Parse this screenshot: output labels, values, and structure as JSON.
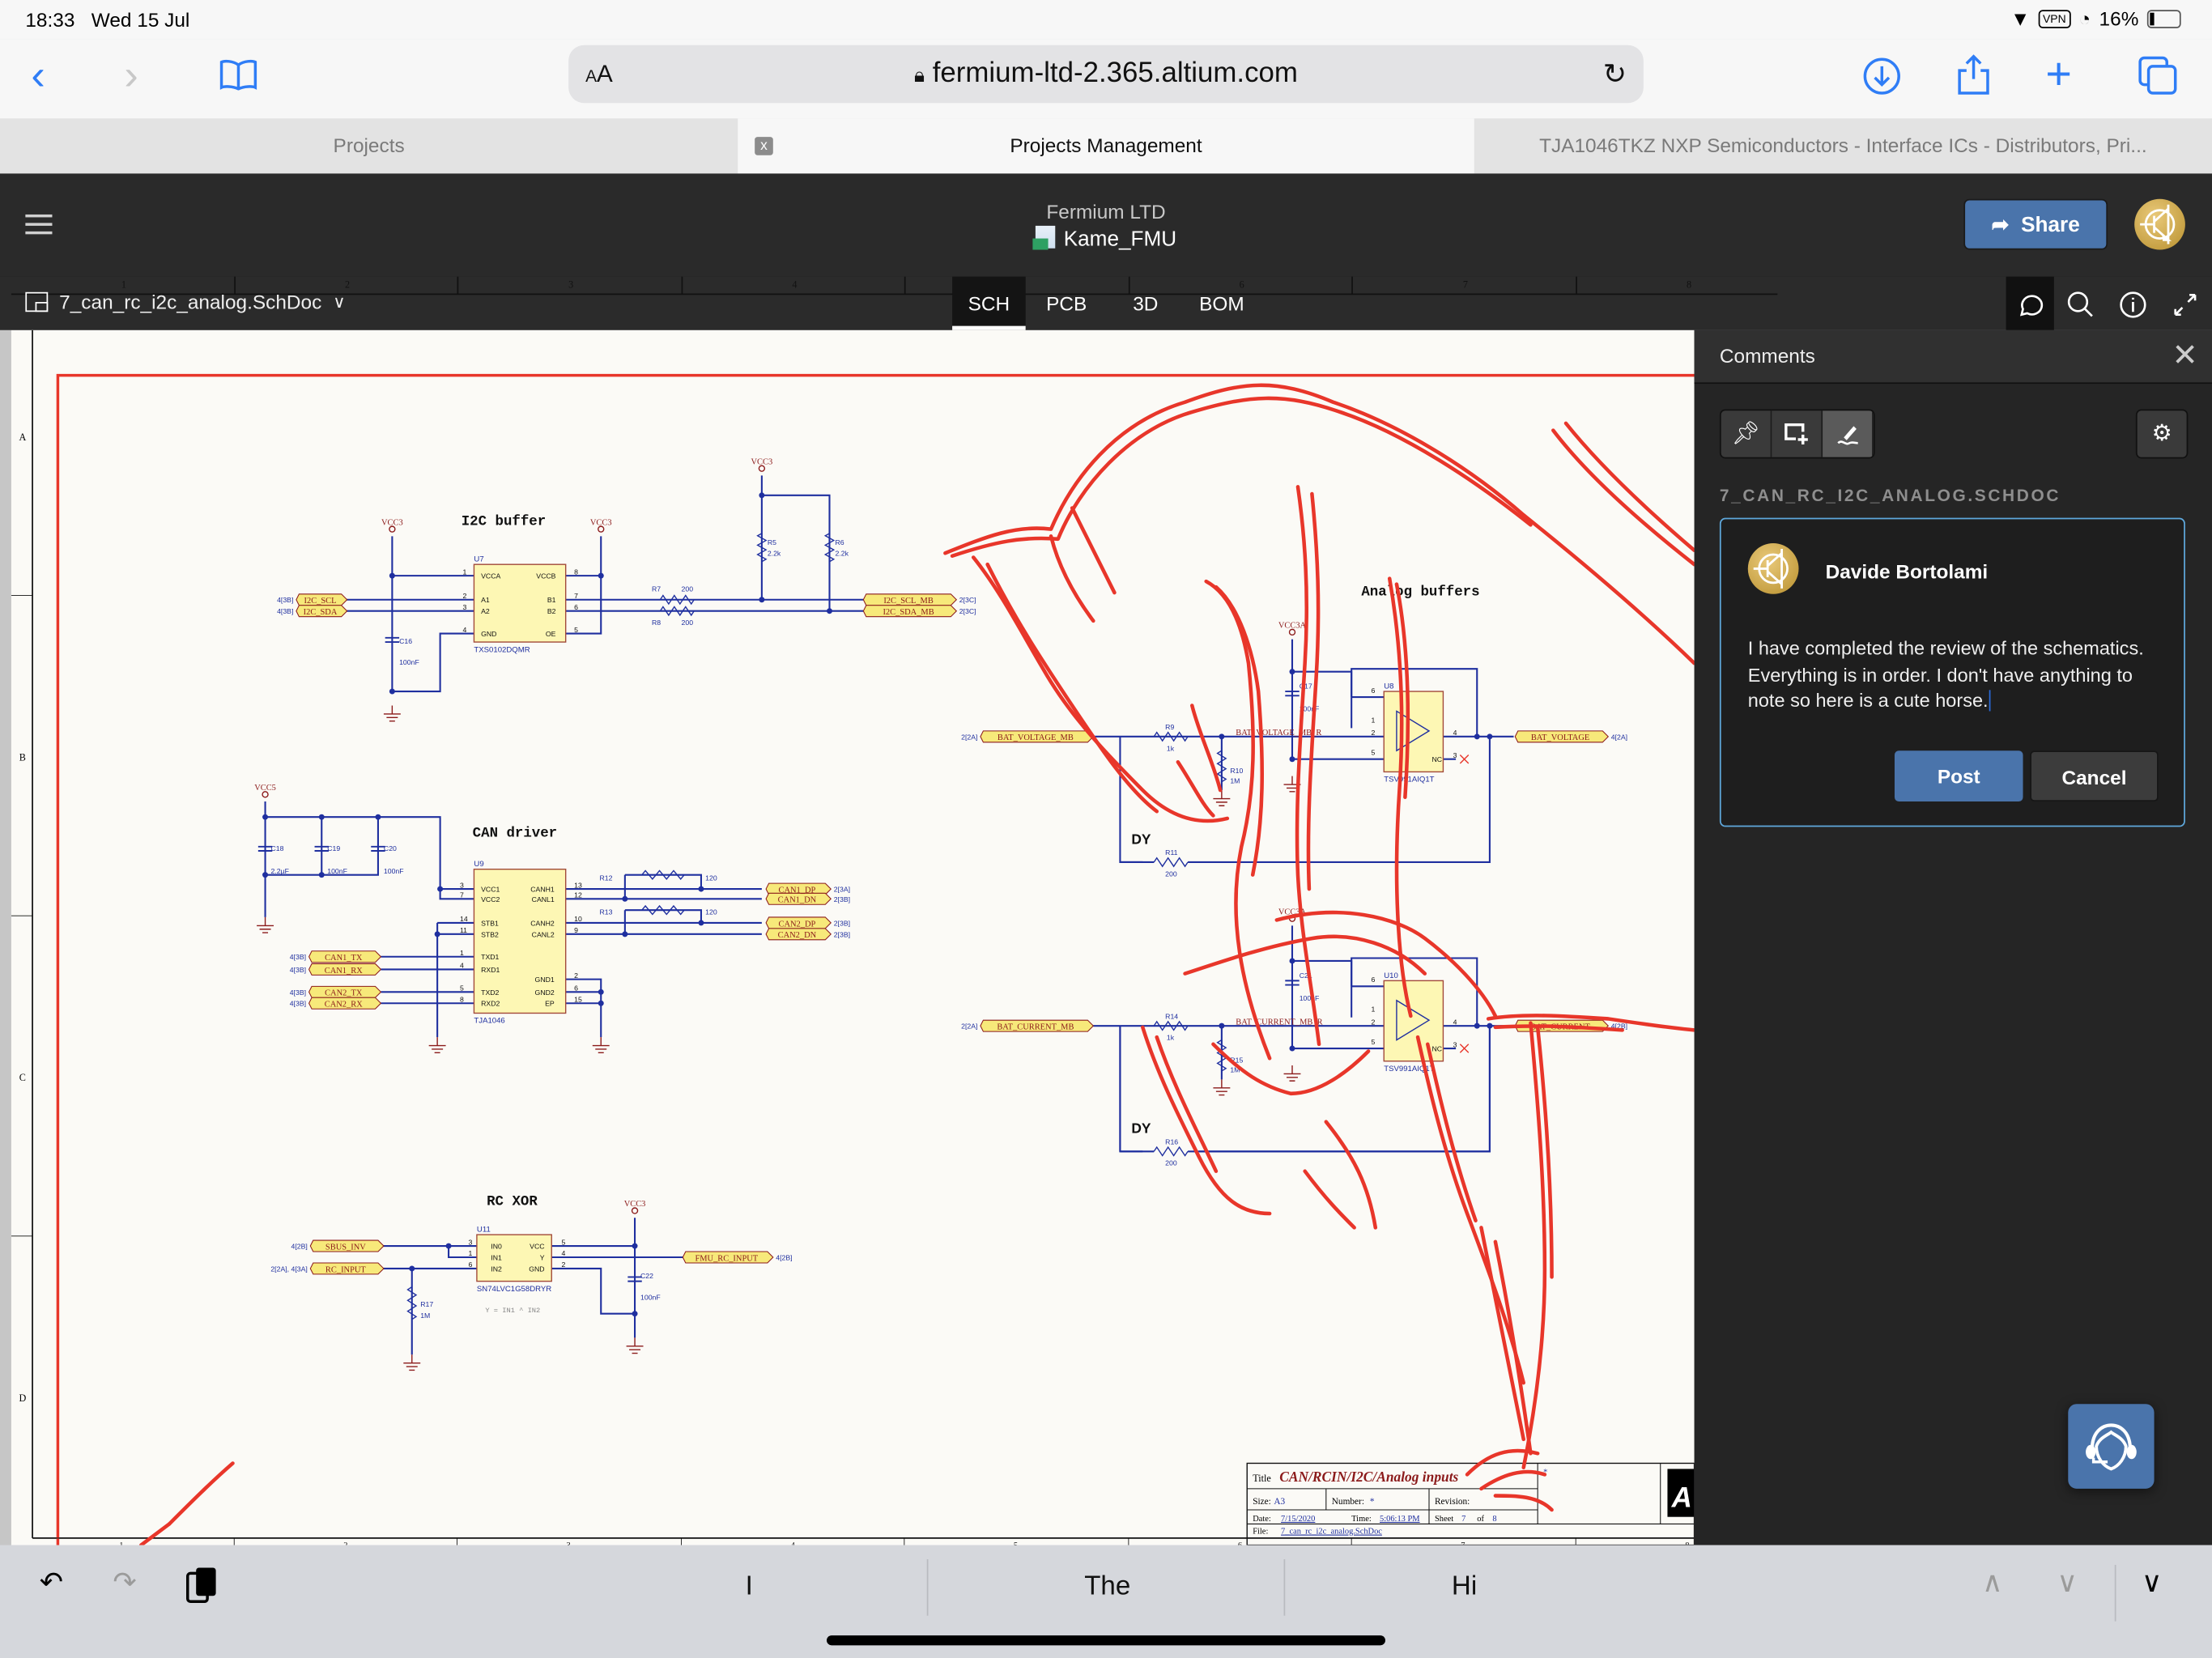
{
  "status_bar": {
    "time": "18:33",
    "date": "Wed 15 Jul",
    "vpn": "VPN",
    "battery": "16%"
  },
  "browser": {
    "url_text_size": "AA",
    "url": "fermium-ltd-2.365.altium.com",
    "icons": [
      "back-icon",
      "forward-icon",
      "bookmarks-icon",
      "download-icon",
      "share-icon",
      "new-tab-icon",
      "tabs-icon",
      "reload-icon",
      "lock-icon"
    ],
    "tabs": [
      {
        "label": "Projects",
        "active": false
      },
      {
        "label": "Projects Management",
        "active": true,
        "close": "x"
      },
      {
        "label": "TJA1046TKZ NXP Semiconductors - Interface ICs - Distributors, Pri...",
        "active": false
      }
    ]
  },
  "app_header": {
    "organization": "Fermium LTD",
    "project": "Kame_FMU",
    "share_label": "Share"
  },
  "view_bar": {
    "document": "7_can_rc_i2c_analog.SchDoc",
    "view_tabs": [
      {
        "label": "SCH",
        "active": true
      },
      {
        "label": "PCB",
        "active": false
      },
      {
        "label": "3D",
        "active": false
      },
      {
        "label": "BOM",
        "active": false
      }
    ],
    "tools": [
      "comments-icon",
      "search-icon",
      "info-icon",
      "fullscreen-icon"
    ],
    "ruler_columns": [
      "1",
      "2",
      "3",
      "4",
      "5",
      "6",
      "7",
      "8"
    ],
    "ruler_rows": [
      "A",
      "B",
      "C",
      "D"
    ]
  },
  "schematic": {
    "sections": {
      "i2c": "I2C buffer",
      "can": "CAN driver",
      "rc": "RC XOR",
      "analog": "Analog buffers"
    },
    "power": {
      "vcc3": "VCC3",
      "vcc5": "VCC5",
      "vcc3a": "VCC3A"
    },
    "i2c": {
      "ic_ref": "U7",
      "ic_part": "TXS0102DQMR",
      "pins_left": [
        "VCCA",
        "A1",
        "A2",
        "GND"
      ],
      "pins_right": [
        "VCCB",
        "B1",
        "B2",
        "OE"
      ],
      "pin_nums_left": [
        "1",
        "2",
        "3",
        "4"
      ],
      "pin_nums_right": [
        "8",
        "7",
        "6",
        "5"
      ],
      "ports_in": [
        {
          "ref": "4[3B]",
          "name": "I2C_SCL"
        },
        {
          "ref": "4[3B]",
          "name": "I2C_SDA"
        }
      ],
      "ports_out": [
        {
          "ref": "2[3C]",
          "name": "I2C_SCL_MB"
        },
        {
          "ref": "2[3C]",
          "name": "I2C_SDA_MB"
        }
      ],
      "c16": {
        "ref": "C16",
        "value": "100nF"
      },
      "r5": {
        "ref": "R5",
        "value": "2.2k"
      },
      "r6": {
        "ref": "R6",
        "value": "2.2k"
      },
      "r7": {
        "ref": "R7",
        "value": "200"
      },
      "r8": {
        "ref": "R8",
        "value": "200"
      }
    },
    "can": {
      "ic_ref": "U9",
      "ic_part": "TJA1046",
      "pins_left": [
        "VCC1",
        "VCC2",
        "STB1",
        "STB2",
        "TXD1",
        "RXD1",
        "TXD2",
        "RXD2"
      ],
      "pin_nums_left": [
        "3",
        "7",
        "14",
        "11",
        "1",
        "4",
        "5",
        "8"
      ],
      "pins_right": [
        "CANH1",
        "CANL1",
        "CANH2",
        "CANL2",
        "GND1",
        "GND2",
        "EP"
      ],
      "pin_nums_right": [
        "13",
        "12",
        "10",
        "9",
        "2",
        "6",
        "15"
      ],
      "caps": [
        {
          "ref": "C18",
          "value": "2.2µF"
        },
        {
          "ref": "C19",
          "value": "100nF"
        },
        {
          "ref": "C20",
          "value": "100nF"
        }
      ],
      "r12": {
        "ref": "R12",
        "value": "120"
      },
      "r13": {
        "ref": "R13",
        "value": "120"
      },
      "ports_in": [
        {
          "ref": "4[3B]",
          "name": "CAN1_TX"
        },
        {
          "ref": "4[3B]",
          "name": "CAN1_RX"
        },
        {
          "ref": "4[3B]",
          "name": "CAN2_TX"
        },
        {
          "ref": "4[3B]",
          "name": "CAN2_RX"
        }
      ],
      "ports_out": [
        {
          "ref": "2[3A]",
          "name": "CAN1_DP"
        },
        {
          "ref": "2[3B]",
          "name": "CAN1_DN"
        },
        {
          "ref": "2[3B]",
          "name": "CAN2_DP"
        },
        {
          "ref": "2[3B]",
          "name": "CAN2_DN"
        }
      ]
    },
    "rc": {
      "ic_ref": "U11",
      "ic_part": "SN74LVC1G58DRYR",
      "pins_left": [
        "IN0",
        "IN1",
        "IN2"
      ],
      "pin_nums_left": [
        "3",
        "1",
        "6"
      ],
      "pins_right": [
        "VCC",
        "Y",
        "GND"
      ],
      "pin_nums_right": [
        "5",
        "4",
        "2"
      ],
      "equation": "Y = IN1 ^ IN2",
      "ports_in": [
        {
          "ref": "4[2B]",
          "name": "SBUS_INV"
        },
        {
          "ref": "2[2A], 4[3A]",
          "name": "RC_INPUT"
        }
      ],
      "port_out": {
        "ref": "4[2B]",
        "name": "FMU_RC_INPUT"
      },
      "r17": {
        "ref": "R17",
        "value": "1M"
      },
      "c22": {
        "ref": "C22",
        "value": "100nF"
      }
    },
    "analog": [
      {
        "in_port": {
          "ref": "2[2A]",
          "name": "BAT_VOLTAGE_MB"
        },
        "out_port": {
          "ref": "4[2A]",
          "name": "BAT_VOLTAGE"
        },
        "net": "BAT_VOLTAGE_MB_R",
        "ic_ref": "U8",
        "ic_part": "TSV991AIQ1T",
        "r_series": {
          "ref": "R9",
          "value": "1k"
        },
        "r_pull": {
          "ref": "R10",
          "value": "1M"
        },
        "r_fb": {
          "ref": "R11",
          "value": "200"
        },
        "cap": {
          "ref": "C17",
          "value": "100nF"
        },
        "dy": "DY",
        "nc": "NC"
      },
      {
        "in_port": {
          "ref": "2[2A]",
          "name": "BAT_CURRENT_MB"
        },
        "out_port": {
          "ref": "4[2B]",
          "name": "BAT_CURRENT"
        },
        "net": "BAT_CURRENT_MB_R",
        "ic_ref": "U10",
        "ic_part": "TSV991AIQ1T",
        "r_series": {
          "ref": "R14",
          "value": "1k"
        },
        "r_pull": {
          "ref": "R15",
          "value": "1M"
        },
        "r_fb": {
          "ref": "R16",
          "value": "200"
        },
        "cap": {
          "ref": "C21",
          "value": "100nF"
        },
        "dy": "DY",
        "nc": "NC"
      }
    ],
    "title_block": {
      "title_label": "Title",
      "title": "CAN/RCIN/I2C/Analog inputs",
      "size_label": "Size:",
      "size": "A3",
      "number_label": "Number:",
      "number": "*",
      "revision_label": "Revision:",
      "date_label": "Date:",
      "date": "7/15/2020",
      "time_label": "Time:",
      "time": "5:06:13 PM",
      "sheet_label": "Sheet",
      "sheet": "7",
      "of_label": "of",
      "sheets": "8",
      "file_label": "File:",
      "file": "7_can_rc_i2c_analog.SchDoc",
      "logo": "A"
    },
    "annotation": {
      "type": "freehand-drawing",
      "subject": "horse",
      "color": "#e8362a"
    }
  },
  "comments_panel": {
    "title": "Comments",
    "tools": [
      "pin-icon",
      "area-comment-icon",
      "freehand-draw-icon"
    ],
    "document_label": "7_CAN_RC_I2C_ANALOG.SCHDOC",
    "draft": {
      "author": "Davide Bortolami",
      "text": "I have completed the review of the schematics. Everything is in order. I don't have anything to note so here is a cute horse.",
      "post_label": "Post",
      "cancel_label": "Cancel"
    }
  },
  "keyboard_bar": {
    "suggestions": [
      "I",
      "The",
      "Hi"
    ]
  },
  "colors": {
    "accent": "#4a74ab",
    "annotation_red": "#e8362a",
    "wire_blue": "#1f2f9f",
    "comment_border": "#5fa8dc",
    "port_fill": "#f7e97a",
    "ic_fill": "#fdf7b4",
    "ic_border": "#a24a3a"
  }
}
